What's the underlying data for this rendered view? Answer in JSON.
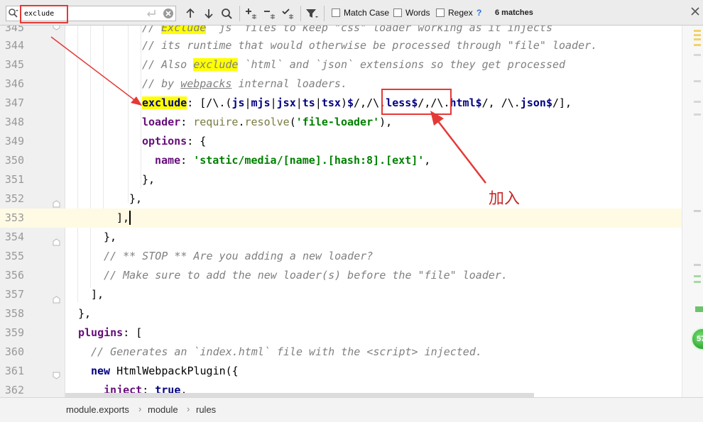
{
  "find_bar": {
    "query": "exclude",
    "match_case_label": "Match Case",
    "words_label": "Words",
    "regex_label": "Regex",
    "help_label": "?",
    "matches_text": "6 matches"
  },
  "editor": {
    "lines": [
      {
        "no": "345"
      },
      {
        "no": "344"
      },
      {
        "no": "345"
      },
      {
        "no": "346"
      },
      {
        "no": "347"
      },
      {
        "no": "348"
      },
      {
        "no": "349"
      },
      {
        "no": "350"
      },
      {
        "no": "351"
      },
      {
        "no": "352"
      },
      {
        "no": "353"
      },
      {
        "no": "354"
      },
      {
        "no": "355"
      },
      {
        "no": "356"
      },
      {
        "no": "357"
      },
      {
        "no": "358"
      },
      {
        "no": "359"
      },
      {
        "no": "360"
      },
      {
        "no": "361"
      },
      {
        "no": "362"
      }
    ],
    "current_line": "353"
  },
  "annotation": {
    "label": "加入",
    "color": "#e53935"
  },
  "status_badge": "57",
  "breadcrumb": {
    "items": [
      "module.exports",
      "module",
      "rules"
    ]
  },
  "colors": {
    "keyword": "#000080",
    "property": "#660e7a",
    "string": "#008000",
    "comment": "#808080",
    "search_highlight": "#ffff00"
  }
}
